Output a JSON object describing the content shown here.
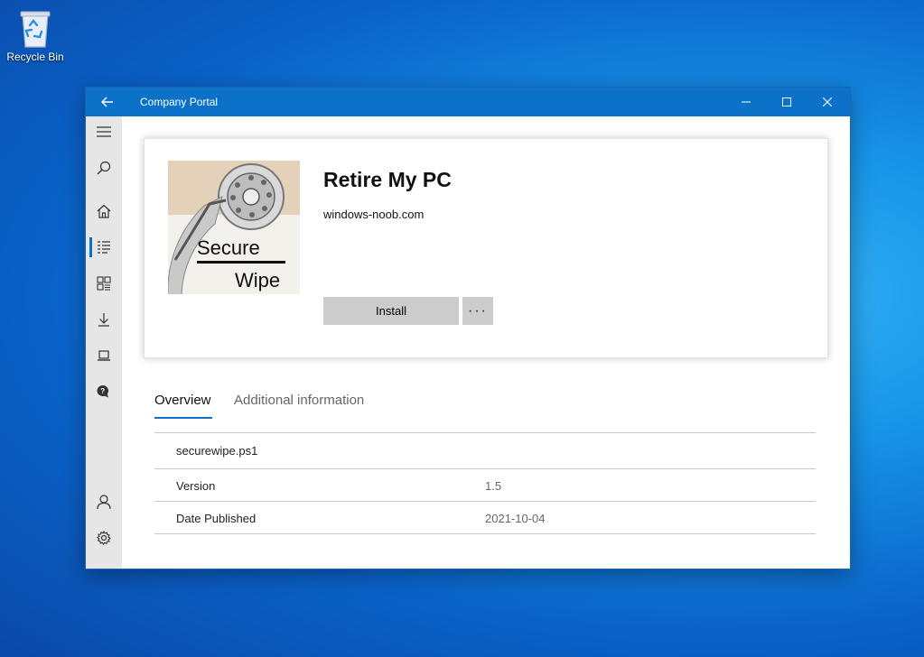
{
  "desktop": {
    "recycle_bin_label": "Recycle Bin"
  },
  "window": {
    "title": "Company Portal",
    "accent_color": "#0c71c8"
  },
  "sidebar": {
    "items": [
      {
        "icon": "hamburger-menu-icon"
      },
      {
        "icon": "search-icon"
      },
      {
        "icon": "home-icon"
      },
      {
        "icon": "apps-list-icon",
        "active": true
      },
      {
        "icon": "app-categories-icon"
      },
      {
        "icon": "downloads-icon"
      },
      {
        "icon": "devices-icon"
      },
      {
        "icon": "help-support-icon"
      },
      {
        "icon": "account-icon"
      },
      {
        "icon": "settings-icon"
      }
    ]
  },
  "app": {
    "title": "Retire My PC",
    "publisher": "windows-noob.com",
    "image_text_line1": "Secure",
    "image_text_line2": "Wipe",
    "install_label": "Install",
    "more_label": "···"
  },
  "tabs": [
    {
      "label": "Overview",
      "active": true
    },
    {
      "label": "Additional information",
      "active": false
    }
  ],
  "details": {
    "filename": "securewipe.ps1",
    "rows": [
      {
        "label": "Version",
        "value": "1.5"
      },
      {
        "label": "Date Published",
        "value": "2021-10-04"
      }
    ]
  }
}
